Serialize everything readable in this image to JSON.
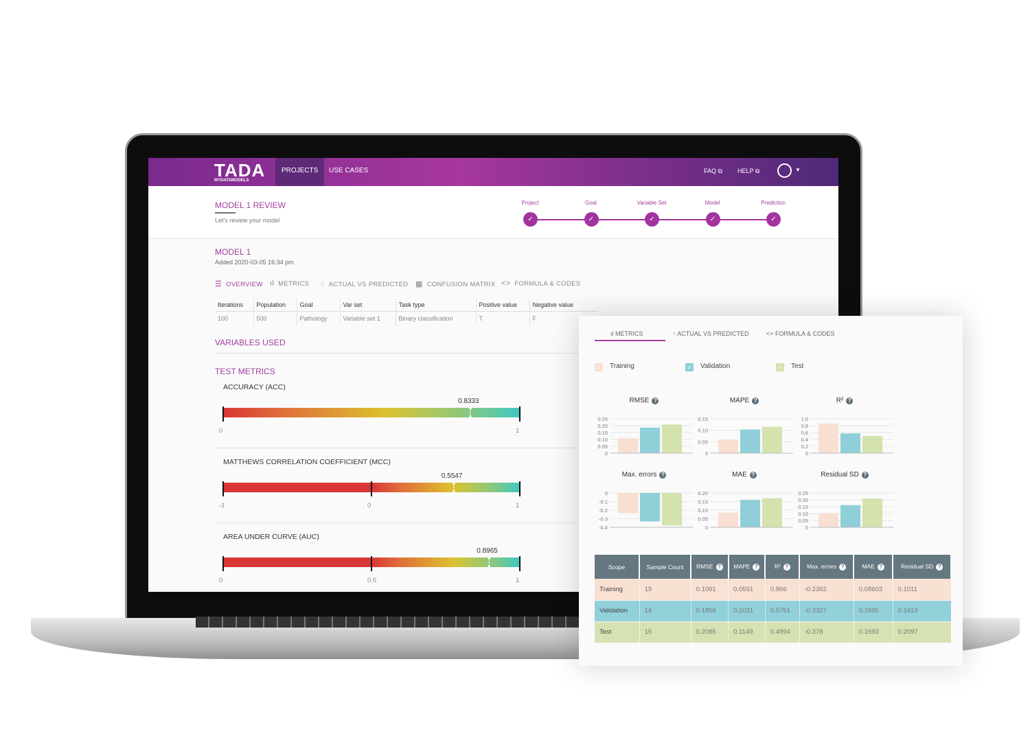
{
  "nav": {
    "logo": "TADA",
    "logo_sub": "MYDATAMODELS",
    "items": [
      "PROJECTS",
      "USE CASES"
    ],
    "faq": "FAQ ⧉",
    "help": "HELP ⧉"
  },
  "header": {
    "title": "MODEL 1 REVIEW",
    "subtitle": "Let's review your model",
    "steps": [
      "Project",
      "Goal",
      "Variable Set",
      "Model",
      "Prediction"
    ]
  },
  "model": {
    "title": "MODEL 1",
    "added": "Added 2020-03-05 16:34 pm",
    "tabs": [
      {
        "icon": "tune-icon",
        "label": "OVERVIEW"
      },
      {
        "icon": "bar-chart-icon",
        "label": "METRICS"
      },
      {
        "icon": "scatter-icon",
        "label": "ACTUAL VS PREDICTED"
      },
      {
        "icon": "grid-icon",
        "label": "CONFUSION MATRIX"
      },
      {
        "icon": "code-icon",
        "label": "FORMULA & CODES"
      }
    ],
    "overview": {
      "headers": [
        "Iterations",
        "Population",
        "Goal",
        "Var set",
        "Task type",
        "Positive value",
        "Negative value"
      ],
      "values": [
        "100",
        "500",
        "Pathology",
        "Variable set 1",
        "Binary classification",
        "T",
        "F"
      ]
    },
    "variables_title": "VARIABLES USED",
    "test_metrics_title": "TEST METRICS",
    "gauges": [
      {
        "title": "ACCURACY (ACC)",
        "value": 0.8333,
        "label": "0.8333",
        "min": 0,
        "max": 1,
        "ticks": [
          "0",
          "1"
        ],
        "mid": null
      },
      {
        "title": "MATTHEWS CORRELATION COEFFICIENT (MCC)",
        "value": 0.5547,
        "label": "0.5547",
        "min": -1,
        "max": 1,
        "ticks": [
          "-1",
          "0",
          "1"
        ],
        "mid": 0
      },
      {
        "title": "AREA UNDER CURVE (AUC)",
        "value": 0.8965,
        "label": "0.8965",
        "min": 0,
        "max": 1,
        "ticks": [
          "0",
          "0.5",
          "1"
        ],
        "mid": 0.5
      }
    ]
  },
  "panel": {
    "tabs": [
      "METRICS",
      "ACTUAL VS PREDICTED",
      "FORMULA & CODES"
    ],
    "legend": [
      {
        "label": "Training",
        "color": "#f8dfd1"
      },
      {
        "label": "Validation",
        "color": "#8fcfd8"
      },
      {
        "label": "Test",
        "color": "#d4e2ae"
      }
    ],
    "table": {
      "headers": [
        "Scope",
        "Sample Count",
        "RMSE",
        "MAPE",
        "R²",
        "Max. errors",
        "MAE",
        "Residual SD"
      ],
      "rows": [
        [
          "Training",
          "19",
          "0.1091",
          "0.0591",
          "0.866",
          "-0.2362",
          "0.08603",
          "0.1011"
        ],
        [
          "Validation",
          "14",
          "0.1858",
          "0.1031",
          "0.5751",
          "-0.3327",
          "0.1595",
          "0.1613"
        ],
        [
          "Test",
          "15",
          "0.2085",
          "0.1149",
          "0.4994",
          "-0.378",
          "0.1693",
          "0.2097"
        ]
      ]
    }
  },
  "chart_data": [
    {
      "type": "bar",
      "title": "RMSE",
      "categories": [
        "Training",
        "Validation",
        "Test"
      ],
      "values": [
        0.1091,
        0.1858,
        0.2085
      ],
      "ylim": [
        0,
        0.25
      ],
      "ticks": [
        "0",
        "0.05",
        "0.10",
        "0.15",
        "0.20",
        "0.25"
      ],
      "grid": true
    },
    {
      "type": "bar",
      "title": "MAPE",
      "categories": [
        "Training",
        "Validation",
        "Test"
      ],
      "values": [
        0.0591,
        0.1031,
        0.1149
      ],
      "ylim": [
        0,
        0.15
      ],
      "ticks": [
        "0",
        "0.05",
        "0.10",
        "0.15"
      ],
      "grid": true
    },
    {
      "type": "bar",
      "title": "R²",
      "categories": [
        "Training",
        "Validation",
        "Test"
      ],
      "values": [
        0.866,
        0.5751,
        0.4994
      ],
      "ylim": [
        0,
        1
      ],
      "ticks": [
        "0",
        "0.2",
        "0.4",
        "0.6",
        "0.8",
        "1.0"
      ],
      "grid": true
    },
    {
      "type": "bar",
      "title": "Max. errors",
      "categories": [
        "Training",
        "Validation",
        "Test"
      ],
      "values": [
        -0.2362,
        -0.3327,
        -0.378
      ],
      "ylim": [
        -0.4,
        0
      ],
      "ticks": [
        "-0.4",
        "-0.3",
        "-0.2",
        "-0.1",
        "0"
      ],
      "grid": true
    },
    {
      "type": "bar",
      "title": "MAE",
      "categories": [
        "Training",
        "Validation",
        "Test"
      ],
      "values": [
        0.08603,
        0.1595,
        0.1693
      ],
      "ylim": [
        0,
        0.2
      ],
      "ticks": [
        "0",
        "0.05",
        "0.10",
        "0.15",
        "0.20"
      ],
      "grid": true
    },
    {
      "type": "bar",
      "title": "Residual SD",
      "categories": [
        "Training",
        "Validation",
        "Test"
      ],
      "values": [
        0.1011,
        0.1613,
        0.2097
      ],
      "ylim": [
        0,
        0.25
      ],
      "ticks": [
        "0",
        "0.05",
        "0.10",
        "0.15",
        "0.20",
        "0.25"
      ],
      "grid": true
    }
  ]
}
